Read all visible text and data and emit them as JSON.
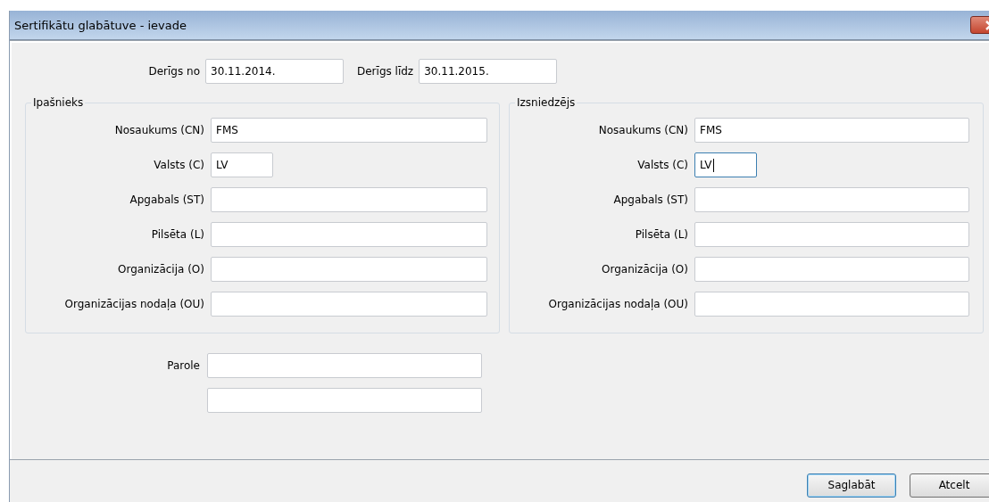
{
  "window": {
    "title": "Sertifikātu glabātuve - ievade"
  },
  "validity": [
    {
      "label": "Derīgs no",
      "value": "30.11.2014."
    },
    {
      "label": "Derīgs līdz",
      "value": "30.11.2015."
    }
  ],
  "groups": [
    {
      "title": "Ipašnieks",
      "fields": [
        {
          "label": "Nosaukums (CN)",
          "value": "FMS",
          "kind": "long",
          "focused": false
        },
        {
          "label": "Valsts (C)",
          "value": "LV",
          "kind": "short",
          "focused": false
        },
        {
          "label": "Apgabals (ST)",
          "kind": "long",
          "focused": false
        },
        {
          "label": "Pilsēta (L)",
          "kind": "long",
          "focused": false
        },
        {
          "label": "Organizācija (O)",
          "kind": "long",
          "focused": false
        },
        {
          "label": "Organizācijas nodaļa (OU)",
          "kind": "long",
          "focused": false
        }
      ]
    },
    {
      "title": "Izsniedzējs",
      "fields": [
        {
          "label": "Nosaukums (CN)",
          "value": "FMS",
          "kind": "long",
          "focused": false
        },
        {
          "label": "Valsts (C)",
          "value": "LV",
          "kind": "short",
          "focused": true
        },
        {
          "label": "Apgabals (ST)",
          "kind": "long",
          "focused": false
        },
        {
          "label": "Pilsēta (L)",
          "kind": "long",
          "focused": false
        },
        {
          "label": "Organizācija (O)",
          "kind": "long",
          "focused": false
        },
        {
          "label": "Organizācijas nodaļa (OU)",
          "kind": "long",
          "focused": false
        }
      ]
    }
  ],
  "password": {
    "label": "Parole"
  },
  "buttons": [
    {
      "label": "Saglabāt",
      "default": true
    },
    {
      "label": "Atcelt",
      "default": false
    }
  ]
}
